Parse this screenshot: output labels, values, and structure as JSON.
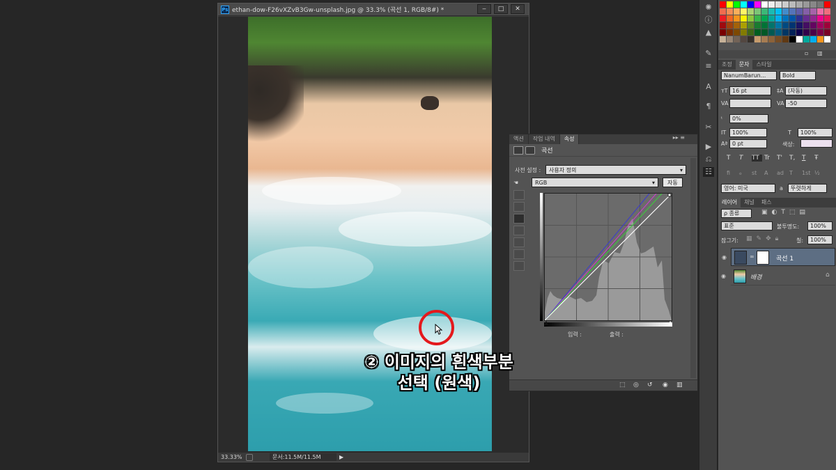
{
  "document": {
    "title": "ethan-dow-F26vXZvB3Gw-unsplash.jpg @ 33.3% (곡선 1, RGB/8#) *",
    "zoom": "33.33%",
    "doc_size": "문서:11.5M/11.5M",
    "window_buttons": [
      "‒",
      "□",
      "✕"
    ]
  },
  "annotation": {
    "line1": "② 이미지의 흰색부분",
    "line2": "선택 (원색)",
    "ring_color": "#e4191c"
  },
  "properties_panel": {
    "tabs": [
      "액션",
      "작업 내역",
      "속성"
    ],
    "active_tab": "속성",
    "menu_icon": "▸▸ ≡",
    "title": "곡선",
    "preset_label": "사전 설정 :",
    "preset_value": "사용자 정의",
    "channel_value": "RGB",
    "auto_button": "자동",
    "input_label": "입력 :",
    "output_label": "출력 :"
  },
  "character_panel": {
    "tabs": [
      "조정",
      "문자",
      "스타일"
    ],
    "active_tab": "문자",
    "font_family": "NanumBarun...",
    "font_style": "Bold",
    "font_size": "16 pt",
    "leading": "(자동)",
    "kerning": "",
    "tracking": "-50",
    "vertical_shift": "0%",
    "horiz_scale": "100%",
    "vert_scale": "100%",
    "baseline": "0 pt",
    "color_label": "색상:",
    "language": "영어: 미국",
    "antialias": "뚜렷하게",
    "aa_label": "a",
    "type_buttons": [
      "T",
      "T",
      "TT",
      "Tr",
      "T'",
      "T,",
      "T",
      "Ŧ"
    ],
    "opentype_buttons": [
      "fi",
      "ℴ",
      "st",
      "A",
      "ad",
      "T",
      "1st",
      "½"
    ]
  },
  "layers_panel": {
    "tabs": [
      "레이어",
      "채널",
      "패스"
    ],
    "active_tab": "레이어",
    "filter_kind": "ρ 종류",
    "blend_mode": "표준",
    "opacity_label": "불투명도:",
    "opacity_value": "100%",
    "lock_label": "잠그기:",
    "fill_label": "칠:",
    "fill_value": "100%",
    "layers": [
      {
        "name": "곡선 1",
        "selected": true
      },
      {
        "name": "배경",
        "selected": false
      }
    ]
  }
}
